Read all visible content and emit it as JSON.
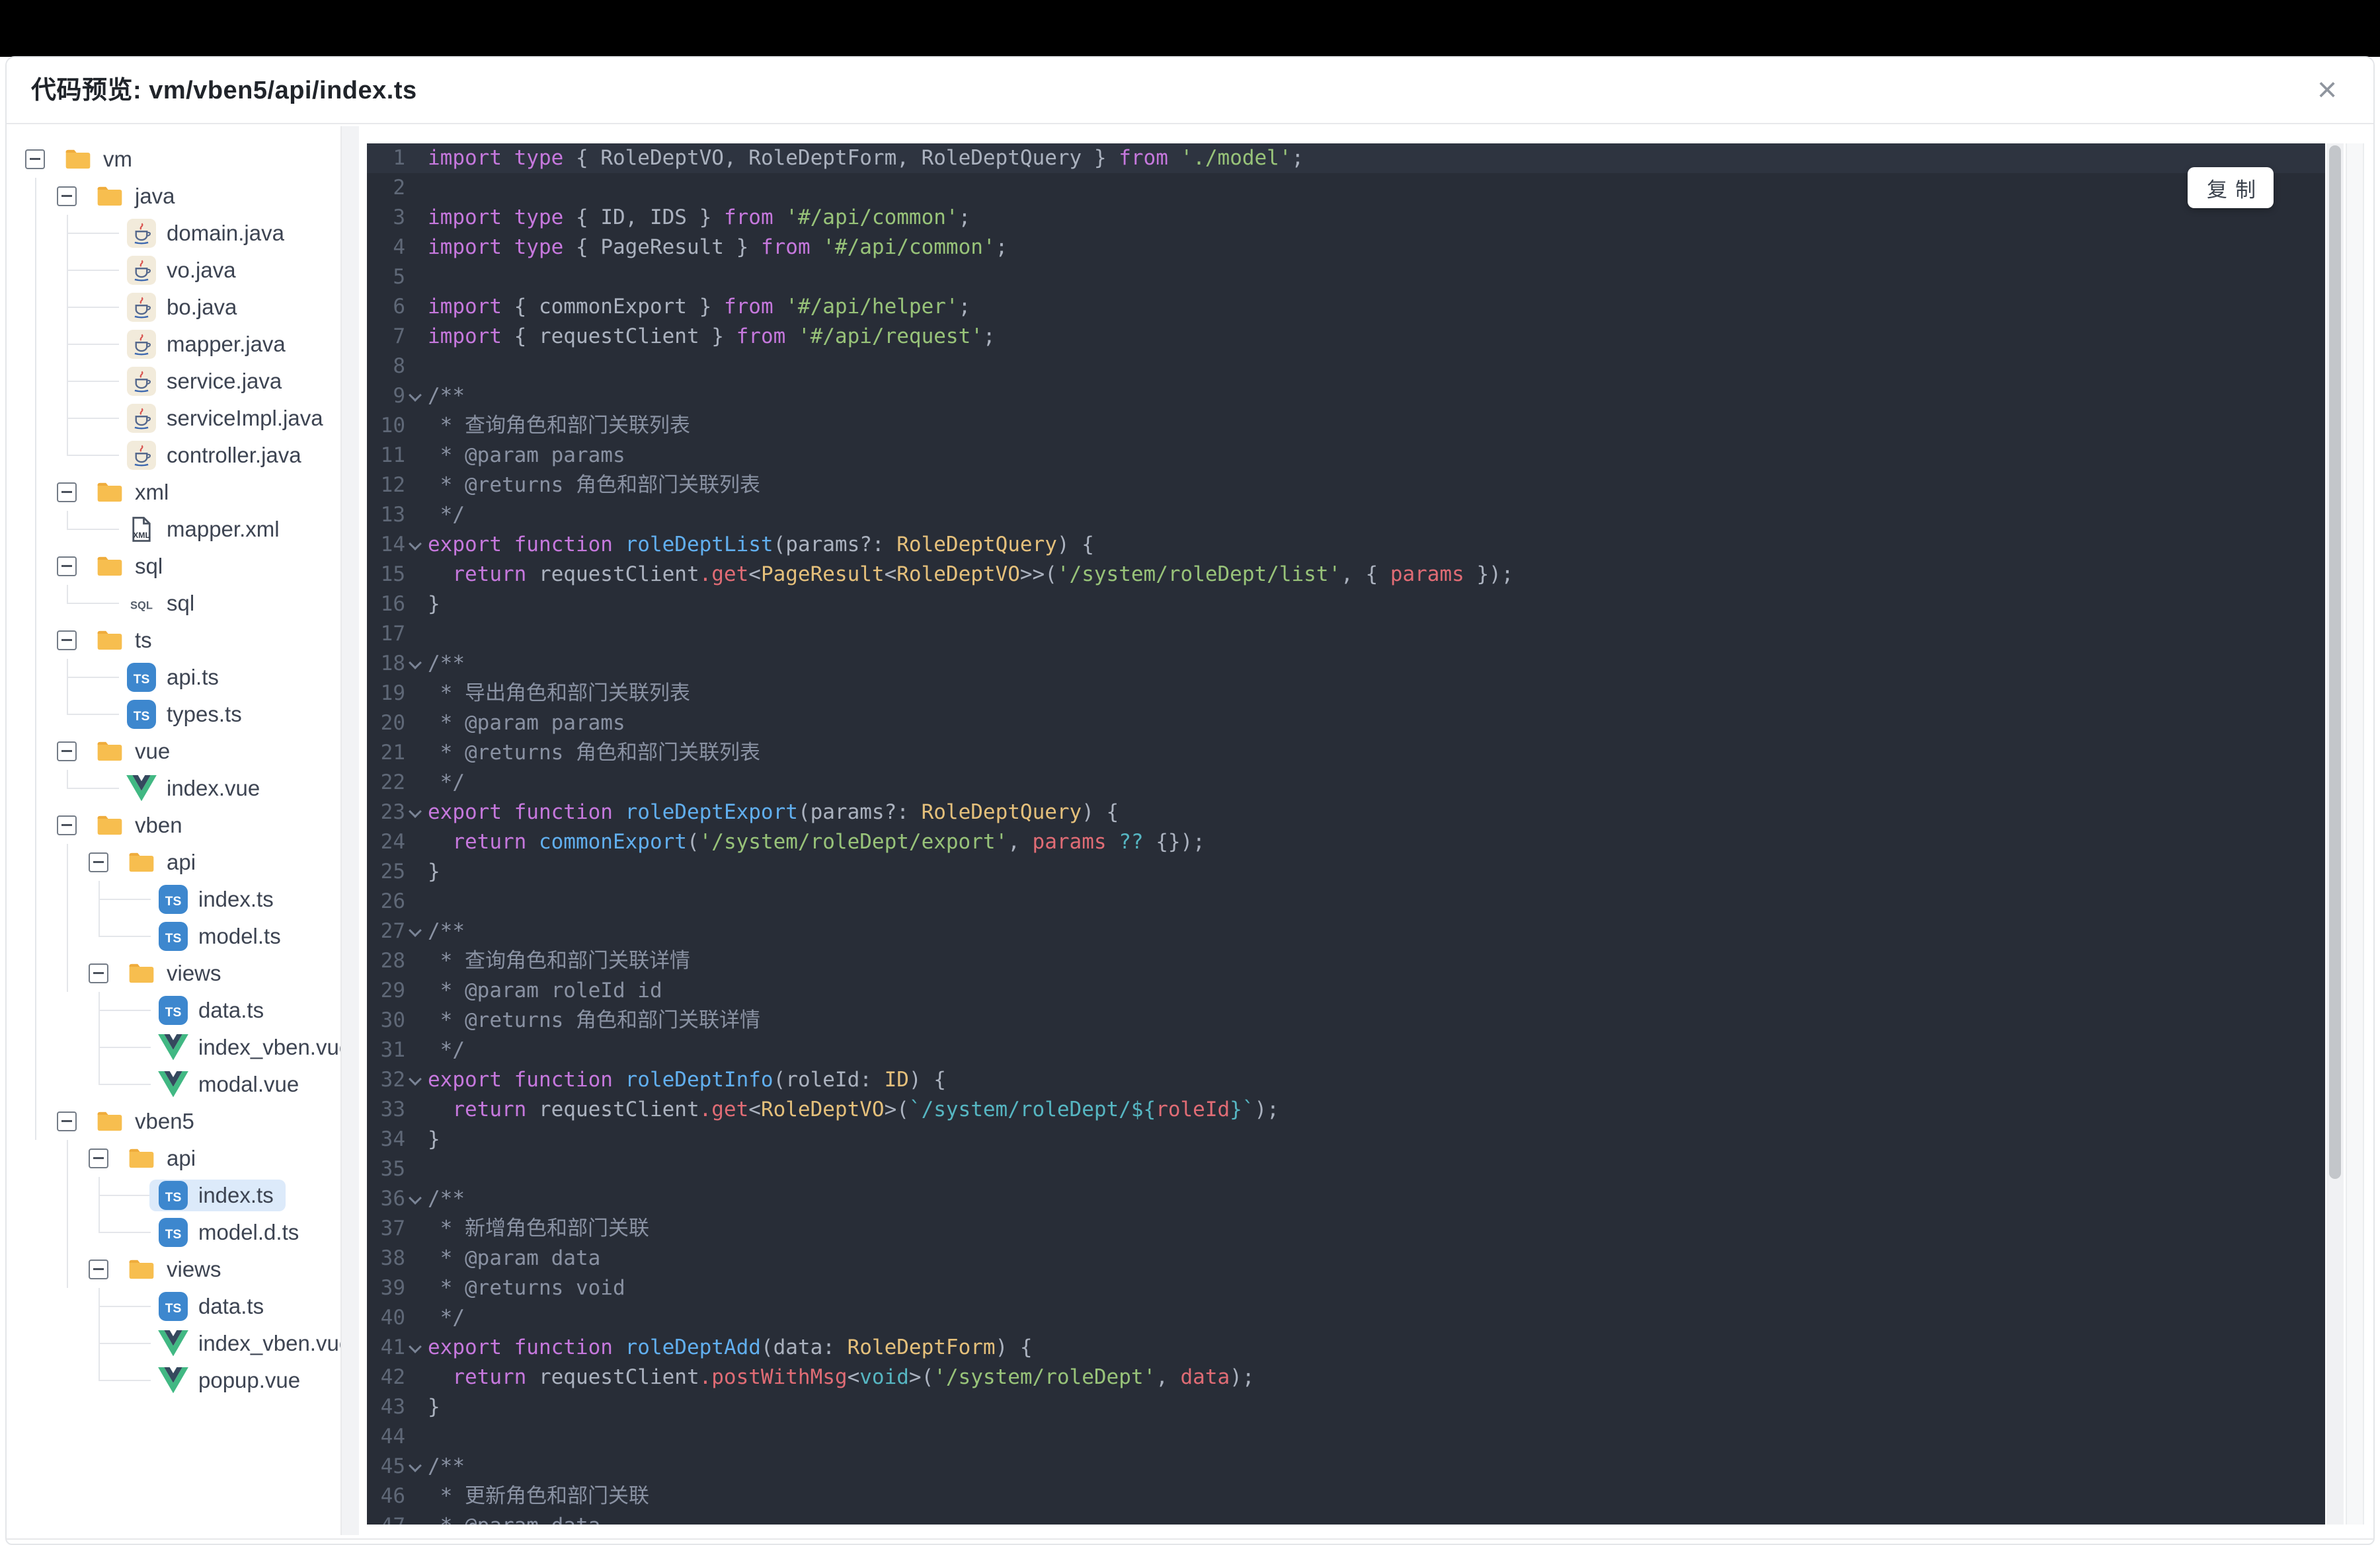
{
  "window": {
    "title": "代码预览: vm/vben5/api/index.ts",
    "close_icon": "×"
  },
  "colors": {
    "selected_item_bg": "#DCEAFA",
    "code_bg": "#282D37",
    "code_active_line_bg": "#2E3440",
    "keyword": "#C678DD",
    "function_name": "#61AFEF",
    "type_name": "#E5C07B",
    "string": "#98C379",
    "property": "#E06C75",
    "operator": "#56B6C2",
    "template_string": "#56B6C2",
    "comment": "#8A92A3",
    "plain": "#ABB2BF",
    "line_number": "#5F6877",
    "folder_icon": "#F7BE4F",
    "ts_badge": "#3D87CE",
    "vue_green": "#41B883",
    "vue_dark": "#35495E"
  },
  "tree": {
    "items": [
      {
        "label": "vm",
        "icon": "folder-icon",
        "depth": 0,
        "toggle": true,
        "guides": []
      },
      {
        "label": "java",
        "icon": "folder-icon",
        "depth": 1,
        "toggle": true,
        "guides": [
          0
        ]
      },
      {
        "label": "domain.java",
        "icon": "java-icon",
        "depth": 2,
        "guides": [
          0
        ],
        "conn": "mid"
      },
      {
        "label": "vo.java",
        "icon": "java-icon",
        "depth": 2,
        "guides": [
          0
        ],
        "conn": "mid"
      },
      {
        "label": "bo.java",
        "icon": "java-icon",
        "depth": 2,
        "guides": [
          0
        ],
        "conn": "mid"
      },
      {
        "label": "mapper.java",
        "icon": "java-icon",
        "depth": 2,
        "guides": [
          0
        ],
        "conn": "mid"
      },
      {
        "label": "service.java",
        "icon": "java-icon",
        "depth": 2,
        "guides": [
          0
        ],
        "conn": "mid"
      },
      {
        "label": "serviceImpl.java",
        "icon": "java-icon",
        "depth": 2,
        "guides": [
          0
        ],
        "conn": "mid"
      },
      {
        "label": "controller.java",
        "icon": "java-icon",
        "depth": 2,
        "guides": [
          0
        ],
        "conn": "last"
      },
      {
        "label": "xml",
        "icon": "folder-icon",
        "depth": 1,
        "toggle": true,
        "guides": [
          0
        ]
      },
      {
        "label": "mapper.xml",
        "icon": "xml-icon",
        "depth": 2,
        "guides": [
          0
        ],
        "conn": "last"
      },
      {
        "label": "sql",
        "icon": "folder-icon",
        "depth": 1,
        "toggle": true,
        "guides": [
          0
        ]
      },
      {
        "label": "sql",
        "icon": "sql-icon",
        "depth": 2,
        "guides": [
          0
        ],
        "conn": "last"
      },
      {
        "label": "ts",
        "icon": "folder-icon",
        "depth": 1,
        "toggle": true,
        "guides": [
          0
        ]
      },
      {
        "label": "api.ts",
        "icon": "ts-icon",
        "depth": 2,
        "guides": [
          0
        ],
        "conn": "mid"
      },
      {
        "label": "types.ts",
        "icon": "ts-icon",
        "depth": 2,
        "guides": [
          0
        ],
        "conn": "last"
      },
      {
        "label": "vue",
        "icon": "folder-icon",
        "depth": 1,
        "toggle": true,
        "guides": [
          0
        ]
      },
      {
        "label": "index.vue",
        "icon": "vue-icon",
        "depth": 2,
        "guides": [
          0
        ],
        "conn": "last"
      },
      {
        "label": "vben",
        "icon": "folder-icon",
        "depth": 1,
        "toggle": true,
        "guides": [
          0
        ]
      },
      {
        "label": "api",
        "icon": "folder-icon",
        "depth": 2,
        "toggle": true,
        "guides": [
          0,
          1
        ]
      },
      {
        "label": "index.ts",
        "icon": "ts-icon",
        "depth": 3,
        "guides": [
          0,
          1
        ],
        "conn": "mid"
      },
      {
        "label": "model.ts",
        "icon": "ts-icon",
        "depth": 3,
        "guides": [
          0,
          1
        ],
        "conn": "last"
      },
      {
        "label": "views",
        "icon": "folder-icon",
        "depth": 2,
        "toggle": true,
        "guides": [
          0,
          1
        ]
      },
      {
        "label": "data.ts",
        "icon": "ts-icon",
        "depth": 3,
        "guides": [
          0
        ],
        "conn": "mid"
      },
      {
        "label": "index_vben.vue",
        "icon": "vue-icon",
        "depth": 3,
        "guides": [
          0
        ],
        "conn": "mid"
      },
      {
        "label": "modal.vue",
        "icon": "vue-icon",
        "depth": 3,
        "guides": [
          0
        ],
        "conn": "last"
      },
      {
        "label": "vben5",
        "icon": "folder-icon",
        "depth": 1,
        "toggle": true,
        "guides": [
          0
        ]
      },
      {
        "label": "api",
        "icon": "folder-icon",
        "depth": 2,
        "toggle": true,
        "guides": [
          1
        ]
      },
      {
        "label": "index.ts",
        "icon": "ts-icon",
        "depth": 3,
        "guides": [
          1
        ],
        "conn": "mid",
        "selected": true
      },
      {
        "label": "model.d.ts",
        "icon": "ts-icon",
        "depth": 3,
        "guides": [
          1
        ],
        "conn": "last"
      },
      {
        "label": "views",
        "icon": "folder-icon",
        "depth": 2,
        "toggle": true,
        "guides": [
          1
        ]
      },
      {
        "label": "data.ts",
        "icon": "ts-icon",
        "depth": 3,
        "guides": [],
        "conn": "mid"
      },
      {
        "label": "index_vben.vue",
        "icon": "vue-icon",
        "depth": 3,
        "guides": [],
        "conn": "mid"
      },
      {
        "label": "popup.vue",
        "icon": "vue-icon",
        "depth": 3,
        "guides": [],
        "conn": "last"
      }
    ]
  },
  "code": {
    "copy_label": "复制",
    "lines": [
      {
        "n": 1,
        "active": true,
        "tokens": [
          [
            "kw",
            "import type"
          ],
          [
            "pun",
            " { "
          ],
          [
            "id",
            "RoleDeptVO"
          ],
          [
            "pun",
            ", "
          ],
          [
            "id",
            "RoleDeptForm"
          ],
          [
            "pun",
            ", "
          ],
          [
            "id",
            "RoleDeptQuery"
          ],
          [
            "pun",
            " } "
          ],
          [
            "kw",
            "from"
          ],
          [
            "str",
            " './model'"
          ],
          [
            "pun",
            ";"
          ]
        ]
      },
      {
        "n": 2,
        "tokens": []
      },
      {
        "n": 3,
        "tokens": [
          [
            "kw",
            "import type"
          ],
          [
            "pun",
            " { "
          ],
          [
            "id",
            "ID"
          ],
          [
            "pun",
            ", "
          ],
          [
            "id",
            "IDS"
          ],
          [
            "pun",
            " } "
          ],
          [
            "kw",
            "from"
          ],
          [
            "str",
            " '#/api/common'"
          ],
          [
            "pun",
            ";"
          ]
        ]
      },
      {
        "n": 4,
        "tokens": [
          [
            "kw",
            "import type"
          ],
          [
            "pun",
            " { "
          ],
          [
            "id",
            "PageResult"
          ],
          [
            "pun",
            " } "
          ],
          [
            "kw",
            "from"
          ],
          [
            "str",
            " '#/api/common'"
          ],
          [
            "pun",
            ";"
          ]
        ]
      },
      {
        "n": 5,
        "tokens": []
      },
      {
        "n": 6,
        "tokens": [
          [
            "kw",
            "import"
          ],
          [
            "pun",
            " { "
          ],
          [
            "id",
            "commonExport"
          ],
          [
            "pun",
            " } "
          ],
          [
            "kw",
            "from"
          ],
          [
            "str",
            " '#/api/helper'"
          ],
          [
            "pun",
            ";"
          ]
        ]
      },
      {
        "n": 7,
        "tokens": [
          [
            "kw",
            "import"
          ],
          [
            "pun",
            " { "
          ],
          [
            "id",
            "requestClient"
          ],
          [
            "pun",
            " } "
          ],
          [
            "kw",
            "from"
          ],
          [
            "str",
            " '#/api/request'"
          ],
          [
            "pun",
            ";"
          ]
        ]
      },
      {
        "n": 8,
        "tokens": []
      },
      {
        "n": 9,
        "fold": true,
        "tokens": [
          [
            "cm",
            "/**"
          ]
        ]
      },
      {
        "n": 10,
        "tokens": [
          [
            "cm",
            " * 查询角色和部门关联列表"
          ]
        ]
      },
      {
        "n": 11,
        "tokens": [
          [
            "cm",
            " * @param params"
          ]
        ]
      },
      {
        "n": 12,
        "tokens": [
          [
            "cm",
            " * @returns 角色和部门关联列表"
          ]
        ]
      },
      {
        "n": 13,
        "tokens": [
          [
            "cm",
            " */"
          ]
        ]
      },
      {
        "n": 14,
        "fold": true,
        "tokens": [
          [
            "kw",
            "export function"
          ],
          [
            "fn",
            " roleDeptList"
          ],
          [
            "pun",
            "("
          ],
          [
            "id",
            "params"
          ],
          [
            "pun",
            "?: "
          ],
          [
            "ty",
            "RoleDeptQuery"
          ],
          [
            "pun",
            ") {"
          ]
        ]
      },
      {
        "n": 15,
        "tokens": [
          [
            "kw",
            "  return"
          ],
          [
            "id",
            " requestClient"
          ],
          [
            "mth",
            ".get"
          ],
          [
            "pun",
            "<"
          ],
          [
            "ty",
            "PageResult"
          ],
          [
            "pun",
            "<"
          ],
          [
            "ty",
            "RoleDeptVO"
          ],
          [
            "pun",
            ">>("
          ],
          [
            "str",
            "'/system/roleDept/list'"
          ],
          [
            "pun",
            ", { "
          ],
          [
            "arg",
            "params"
          ],
          [
            "pun",
            " });"
          ]
        ]
      },
      {
        "n": 16,
        "tokens": [
          [
            "pun",
            "}"
          ]
        ]
      },
      {
        "n": 17,
        "tokens": []
      },
      {
        "n": 18,
        "fold": true,
        "tokens": [
          [
            "cm",
            "/**"
          ]
        ]
      },
      {
        "n": 19,
        "tokens": [
          [
            "cm",
            " * 导出角色和部门关联列表"
          ]
        ]
      },
      {
        "n": 20,
        "tokens": [
          [
            "cm",
            " * @param params"
          ]
        ]
      },
      {
        "n": 21,
        "tokens": [
          [
            "cm",
            " * @returns 角色和部门关联列表"
          ]
        ]
      },
      {
        "n": 22,
        "tokens": [
          [
            "cm",
            " */"
          ]
        ]
      },
      {
        "n": 23,
        "fold": true,
        "tokens": [
          [
            "kw",
            "export function"
          ],
          [
            "fn",
            " roleDeptExport"
          ],
          [
            "pun",
            "("
          ],
          [
            "id",
            "params"
          ],
          [
            "pun",
            "?: "
          ],
          [
            "ty",
            "RoleDeptQuery"
          ],
          [
            "pun",
            ") {"
          ]
        ]
      },
      {
        "n": 24,
        "tokens": [
          [
            "kw",
            "  return"
          ],
          [
            "fn",
            " commonExport"
          ],
          [
            "pun",
            "("
          ],
          [
            "str",
            "'/system/roleDept/export'"
          ],
          [
            "pun",
            ", "
          ],
          [
            "arg",
            "params"
          ],
          [
            "op",
            " ??"
          ],
          [
            "pun",
            " {});"
          ]
        ]
      },
      {
        "n": 25,
        "tokens": [
          [
            "pun",
            "}"
          ]
        ]
      },
      {
        "n": 26,
        "tokens": []
      },
      {
        "n": 27,
        "fold": true,
        "tokens": [
          [
            "cm",
            "/**"
          ]
        ]
      },
      {
        "n": 28,
        "tokens": [
          [
            "cm",
            " * 查询角色和部门关联详情"
          ]
        ]
      },
      {
        "n": 29,
        "tokens": [
          [
            "cm",
            " * @param roleId id"
          ]
        ]
      },
      {
        "n": 30,
        "tokens": [
          [
            "cm",
            " * @returns 角色和部门关联详情"
          ]
        ]
      },
      {
        "n": 31,
        "tokens": [
          [
            "cm",
            " */"
          ]
        ]
      },
      {
        "n": 32,
        "fold": true,
        "tokens": [
          [
            "kw",
            "export function"
          ],
          [
            "fn",
            " roleDeptInfo"
          ],
          [
            "pun",
            "("
          ],
          [
            "id",
            "roleId"
          ],
          [
            "pun",
            ": "
          ],
          [
            "ty",
            "ID"
          ],
          [
            "pun",
            ") {"
          ]
        ]
      },
      {
        "n": 33,
        "tokens": [
          [
            "kw",
            "  return"
          ],
          [
            "id",
            " requestClient"
          ],
          [
            "mth",
            ".get"
          ],
          [
            "pun",
            "<"
          ],
          [
            "ty",
            "RoleDeptVO"
          ],
          [
            "pun",
            ">("
          ],
          [
            "tpl",
            "`/system/roleDept/"
          ],
          [
            "op",
            "${"
          ],
          [
            "arg",
            "roleId"
          ],
          [
            "op",
            "}"
          ],
          [
            "tpl",
            "`"
          ],
          [
            "pun",
            ");"
          ]
        ]
      },
      {
        "n": 34,
        "tokens": [
          [
            "pun",
            "}"
          ]
        ]
      },
      {
        "n": 35,
        "tokens": []
      },
      {
        "n": 36,
        "fold": true,
        "tokens": [
          [
            "cm",
            "/**"
          ]
        ]
      },
      {
        "n": 37,
        "tokens": [
          [
            "cm",
            " * 新增角色和部门关联"
          ]
        ]
      },
      {
        "n": 38,
        "tokens": [
          [
            "cm",
            " * @param data"
          ]
        ]
      },
      {
        "n": 39,
        "tokens": [
          [
            "cm",
            " * @returns void"
          ]
        ]
      },
      {
        "n": 40,
        "tokens": [
          [
            "cm",
            " */"
          ]
        ]
      },
      {
        "n": 41,
        "fold": true,
        "tokens": [
          [
            "kw",
            "export function"
          ],
          [
            "fn",
            " roleDeptAdd"
          ],
          [
            "pun",
            "("
          ],
          [
            "id",
            "data"
          ],
          [
            "pun",
            ": "
          ],
          [
            "ty",
            "RoleDeptForm"
          ],
          [
            "pun",
            ") {"
          ]
        ]
      },
      {
        "n": 42,
        "tokens": [
          [
            "kw",
            "  return"
          ],
          [
            "id",
            " requestClient"
          ],
          [
            "mth",
            ".postWithMsg"
          ],
          [
            "pun",
            "<"
          ],
          [
            "op",
            "void"
          ],
          [
            "pun",
            ">("
          ],
          [
            "str",
            "'/system/roleDept'"
          ],
          [
            "pun",
            ", "
          ],
          [
            "arg",
            "data"
          ],
          [
            "pun",
            ");"
          ]
        ]
      },
      {
        "n": 43,
        "tokens": [
          [
            "pun",
            "}"
          ]
        ]
      },
      {
        "n": 44,
        "tokens": []
      },
      {
        "n": 45,
        "fold": true,
        "tokens": [
          [
            "cm",
            "/**"
          ]
        ]
      },
      {
        "n": 46,
        "tokens": [
          [
            "cm",
            " * 更新角色和部门关联"
          ]
        ]
      },
      {
        "n": 47,
        "tokens": [
          [
            "cm",
            " * @param data"
          ]
        ]
      }
    ]
  }
}
